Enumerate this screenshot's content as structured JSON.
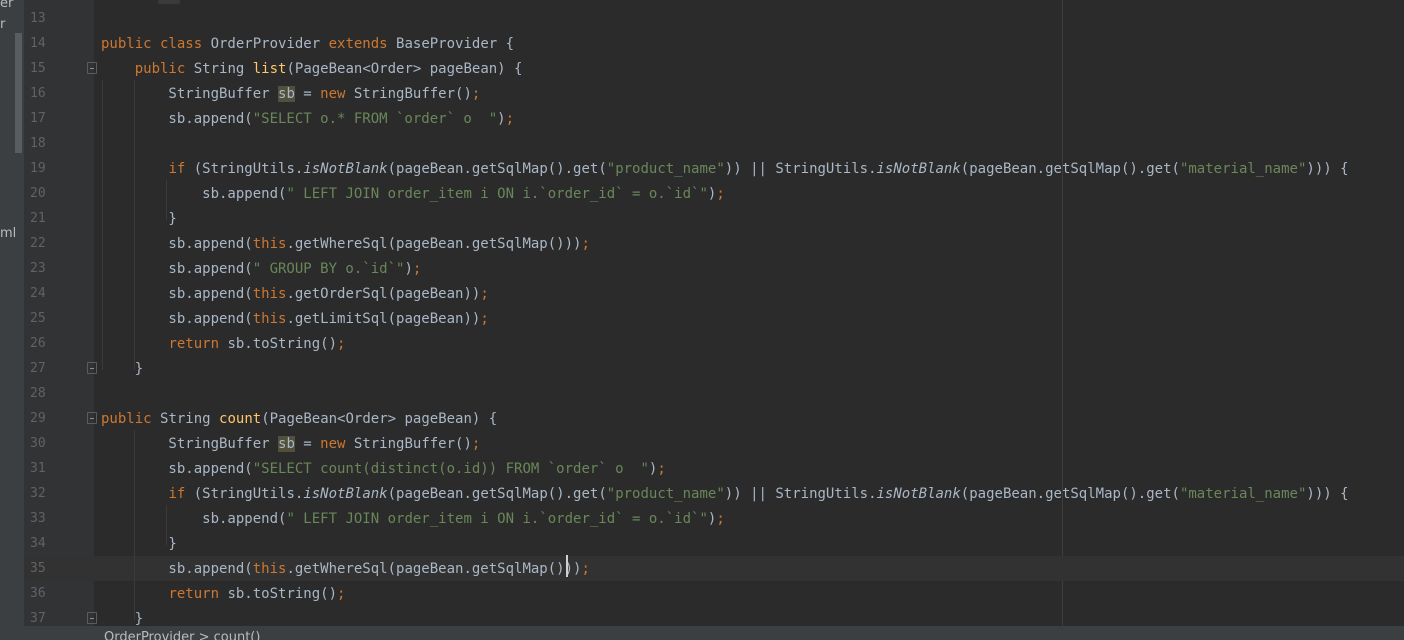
{
  "project_panel": {
    "labels": [
      "er",
      "r",
      "ml"
    ]
  },
  "editor": {
    "status_breadcrumb": "OrderProvider > count()",
    "lines": [
      {
        "num": "13",
        "segments": []
      },
      {
        "num": "14",
        "segments": [
          {
            "t": "public class ",
            "c": "kw"
          },
          {
            "t": "OrderProvider "
          },
          {
            "t": "extends ",
            "c": "kw"
          },
          {
            "t": "BaseProvider {"
          }
        ]
      },
      {
        "num": "15",
        "segments": [
          {
            "t": "    "
          },
          {
            "t": "public ",
            "c": "kw"
          },
          {
            "t": "String "
          },
          {
            "t": "list",
            "c": "fn"
          },
          {
            "t": "(PageBean<Order> pageBean) {"
          }
        ]
      },
      {
        "num": "16",
        "segments": [
          {
            "t": "        StringBuffer "
          },
          {
            "t": "sb",
            "c": "hl"
          },
          {
            "t": " = "
          },
          {
            "t": "new ",
            "c": "kw"
          },
          {
            "t": "StringBuffer()"
          },
          {
            "t": ";",
            "c": "kw"
          }
        ]
      },
      {
        "num": "17",
        "segments": [
          {
            "t": "        sb.append("
          },
          {
            "t": "\"SELECT o.* FROM `order` o  \"",
            "c": "str"
          },
          {
            "t": ")"
          },
          {
            "t": ";",
            "c": "kw"
          }
        ]
      },
      {
        "num": "18",
        "segments": []
      },
      {
        "num": "19",
        "segments": [
          {
            "t": "        "
          },
          {
            "t": "if ",
            "c": "kw"
          },
          {
            "t": "(StringUtils."
          },
          {
            "t": "isNotBlank",
            "c": "ital"
          },
          {
            "t": "(pageBean.getSqlMap().get("
          },
          {
            "t": "\"product_name\"",
            "c": "str"
          },
          {
            "t": ")) || StringUtils."
          },
          {
            "t": "isNotBlank",
            "c": "ital"
          },
          {
            "t": "(pageBean.getSqlMap().get("
          },
          {
            "t": "\"material_name\"",
            "c": "str"
          },
          {
            "t": "))) {"
          }
        ]
      },
      {
        "num": "20",
        "segments": [
          {
            "t": "            sb.append("
          },
          {
            "t": "\" LEFT JOIN order_item i ON i.`order_id` = o.`id`\"",
            "c": "str"
          },
          {
            "t": ")"
          },
          {
            "t": ";",
            "c": "kw"
          }
        ]
      },
      {
        "num": "21",
        "segments": [
          {
            "t": "        }"
          }
        ]
      },
      {
        "num": "22",
        "segments": [
          {
            "t": "        sb.append("
          },
          {
            "t": "this",
            "c": "kw"
          },
          {
            "t": ".getWhereSql(pageBean.getSqlMap()))"
          },
          {
            "t": ";",
            "c": "kw"
          }
        ]
      },
      {
        "num": "23",
        "segments": [
          {
            "t": "        sb.append("
          },
          {
            "t": "\" GROUP BY o.`id`\"",
            "c": "str"
          },
          {
            "t": ")"
          },
          {
            "t": ";",
            "c": "kw"
          }
        ]
      },
      {
        "num": "24",
        "segments": [
          {
            "t": "        sb.append("
          },
          {
            "t": "this",
            "c": "kw"
          },
          {
            "t": ".getOrderSql(pageBean))"
          },
          {
            "t": ";",
            "c": "kw"
          }
        ]
      },
      {
        "num": "25",
        "segments": [
          {
            "t": "        sb.append("
          },
          {
            "t": "this",
            "c": "kw"
          },
          {
            "t": ".getLimitSql(pageBean))"
          },
          {
            "t": ";",
            "c": "kw"
          }
        ]
      },
      {
        "num": "26",
        "segments": [
          {
            "t": "        "
          },
          {
            "t": "return ",
            "c": "kw"
          },
          {
            "t": "sb.toString()"
          },
          {
            "t": ";",
            "c": "kw"
          }
        ]
      },
      {
        "num": "27",
        "segments": [
          {
            "t": "    }"
          }
        ]
      },
      {
        "num": "28",
        "segments": []
      },
      {
        "num": "29",
        "segments": [
          {
            "t": "public ",
            "c": "kw"
          },
          {
            "t": "String "
          },
          {
            "t": "count",
            "c": "fn"
          },
          {
            "t": "(PageBean<Order> pageBean) {"
          }
        ]
      },
      {
        "num": "30",
        "segments": [
          {
            "t": "        StringBuffer "
          },
          {
            "t": "sb",
            "c": "hl"
          },
          {
            "t": " = "
          },
          {
            "t": "new ",
            "c": "kw"
          },
          {
            "t": "StringBuffer()"
          },
          {
            "t": ";",
            "c": "kw"
          }
        ]
      },
      {
        "num": "31",
        "segments": [
          {
            "t": "        sb.append("
          },
          {
            "t": "\"SELECT count(distinct(o.id)) FROM `order` o  \"",
            "c": "str"
          },
          {
            "t": ")"
          },
          {
            "t": ";",
            "c": "kw"
          }
        ]
      },
      {
        "num": "32",
        "segments": [
          {
            "t": "        "
          },
          {
            "t": "if ",
            "c": "kw"
          },
          {
            "t": "(StringUtils."
          },
          {
            "t": "isNotBlank",
            "c": "ital"
          },
          {
            "t": "(pageBean.getSqlMap().get("
          },
          {
            "t": "\"product_name\"",
            "c": "str"
          },
          {
            "t": ")) || StringUtils."
          },
          {
            "t": "isNotBlank",
            "c": "ital"
          },
          {
            "t": "(pageBean.getSqlMap().get("
          },
          {
            "t": "\"material_name\"",
            "c": "str"
          },
          {
            "t": "))) {"
          }
        ]
      },
      {
        "num": "33",
        "segments": [
          {
            "t": "            sb.append("
          },
          {
            "t": "\" LEFT JOIN order_item i ON i.`order_id` = o.`id`\"",
            "c": "str"
          },
          {
            "t": ")"
          },
          {
            "t": ";",
            "c": "kw"
          }
        ]
      },
      {
        "num": "34",
        "segments": [
          {
            "t": "        }"
          }
        ]
      },
      {
        "num": "35",
        "segments": [
          {
            "t": "        sb.append("
          },
          {
            "t": "this",
            "c": "kw"
          },
          {
            "t": ".getWhereSql(pageBean.getSqlMap()))"
          },
          {
            "t": ";",
            "c": "kw"
          }
        ]
      },
      {
        "num": "36",
        "segments": [
          {
            "t": "        "
          },
          {
            "t": "return ",
            "c": "kw"
          },
          {
            "t": "sb.toString()"
          },
          {
            "t": ";",
            "c": "kw"
          }
        ]
      },
      {
        "num": "37",
        "segments": [
          {
            "t": "    }"
          }
        ]
      }
    ]
  }
}
